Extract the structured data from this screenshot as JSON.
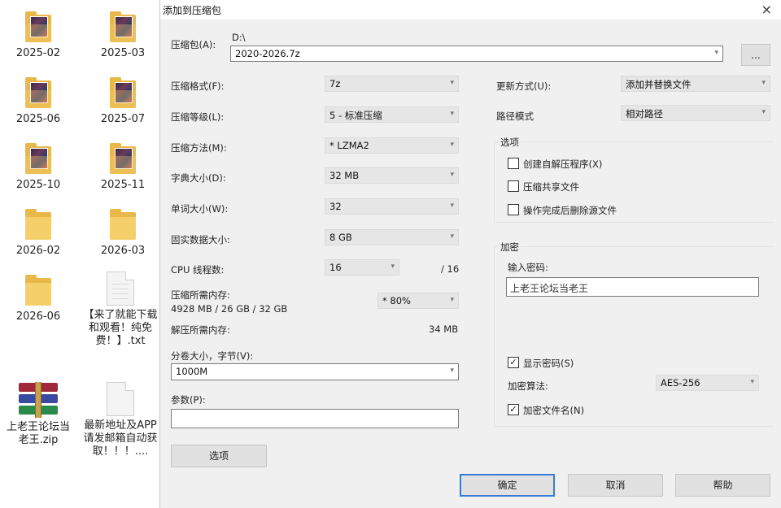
{
  "desktop": {
    "icons": [
      {
        "label": "2025-02"
      },
      {
        "label": "2025-03"
      },
      {
        "label": "2025-06"
      },
      {
        "label": "2025-07"
      },
      {
        "label": "2025-10"
      },
      {
        "label": "2025-11"
      },
      {
        "label": "2026-02"
      },
      {
        "label": "2026-03"
      },
      {
        "label": "2026-06"
      },
      {
        "label": "【来了就能下载和观看！纯免费！】.txt"
      },
      {
        "label": "上老王论坛当老王.zip"
      },
      {
        "label": "最新地址及APP请发邮箱自动获取！！！...."
      }
    ]
  },
  "dialog": {
    "title": "添加到压缩包",
    "close_glyph": "×",
    "archive": {
      "label": "压缩包(A):",
      "path": "D:\\",
      "filename": "2020-2026.7z",
      "browse_label": "..."
    },
    "left": {
      "format": {
        "label": "压缩格式(F):",
        "value": "7z"
      },
      "level": {
        "label": "压缩等级(L):",
        "value": "5 - 标准压缩"
      },
      "method": {
        "label": "压缩方法(M):",
        "value": "*  LZMA2"
      },
      "dict": {
        "label": "字典大小(D):",
        "value": "32 MB"
      },
      "word": {
        "label": "单词大小(W):",
        "value": "32"
      },
      "solid": {
        "label": "固实数据大小:",
        "value": "8 GB"
      },
      "threads": {
        "label": "CPU 线程数:",
        "value": "16",
        "total": "/ 16"
      },
      "mem_compress": {
        "label": "压缩所需内存:",
        "detail": "4928 MB / 26 GB / 32 GB",
        "value": "* 80%"
      },
      "mem_decompress": {
        "label": "解压所需内存:",
        "value": "34 MB"
      },
      "split": {
        "label": "分卷大小，字节(V):",
        "value": "1000M"
      },
      "params": {
        "label": "参数(P):",
        "value": ""
      },
      "options_button": "选项"
    },
    "right": {
      "update": {
        "label": "更新方式(U):",
        "value": "添加并替换文件"
      },
      "pathmode": {
        "label": "路径模式",
        "value": "相对路径"
      },
      "options": {
        "heading": "选项",
        "sfx": {
          "label": "创建自解压程序(X)",
          "checked": false
        },
        "shared": {
          "label": "压缩共享文件",
          "checked": false
        },
        "delete": {
          "label": "操作完成后删除源文件",
          "checked": false
        }
      },
      "encryption": {
        "heading": "加密",
        "password_label": "输入密码:",
        "password_value": "上老王论坛当老王",
        "show_password": {
          "label": "显示密码(S)",
          "checked": true
        },
        "algo_label": "加密算法:",
        "algo_value": "AES-256",
        "encrypt_names": {
          "label": "加密文件名(N)",
          "checked": true
        }
      }
    },
    "buttons": {
      "ok": "确定",
      "cancel": "取消",
      "help": "帮助"
    },
    "check_glyph": "✓",
    "arrow_glyph": "▾"
  }
}
